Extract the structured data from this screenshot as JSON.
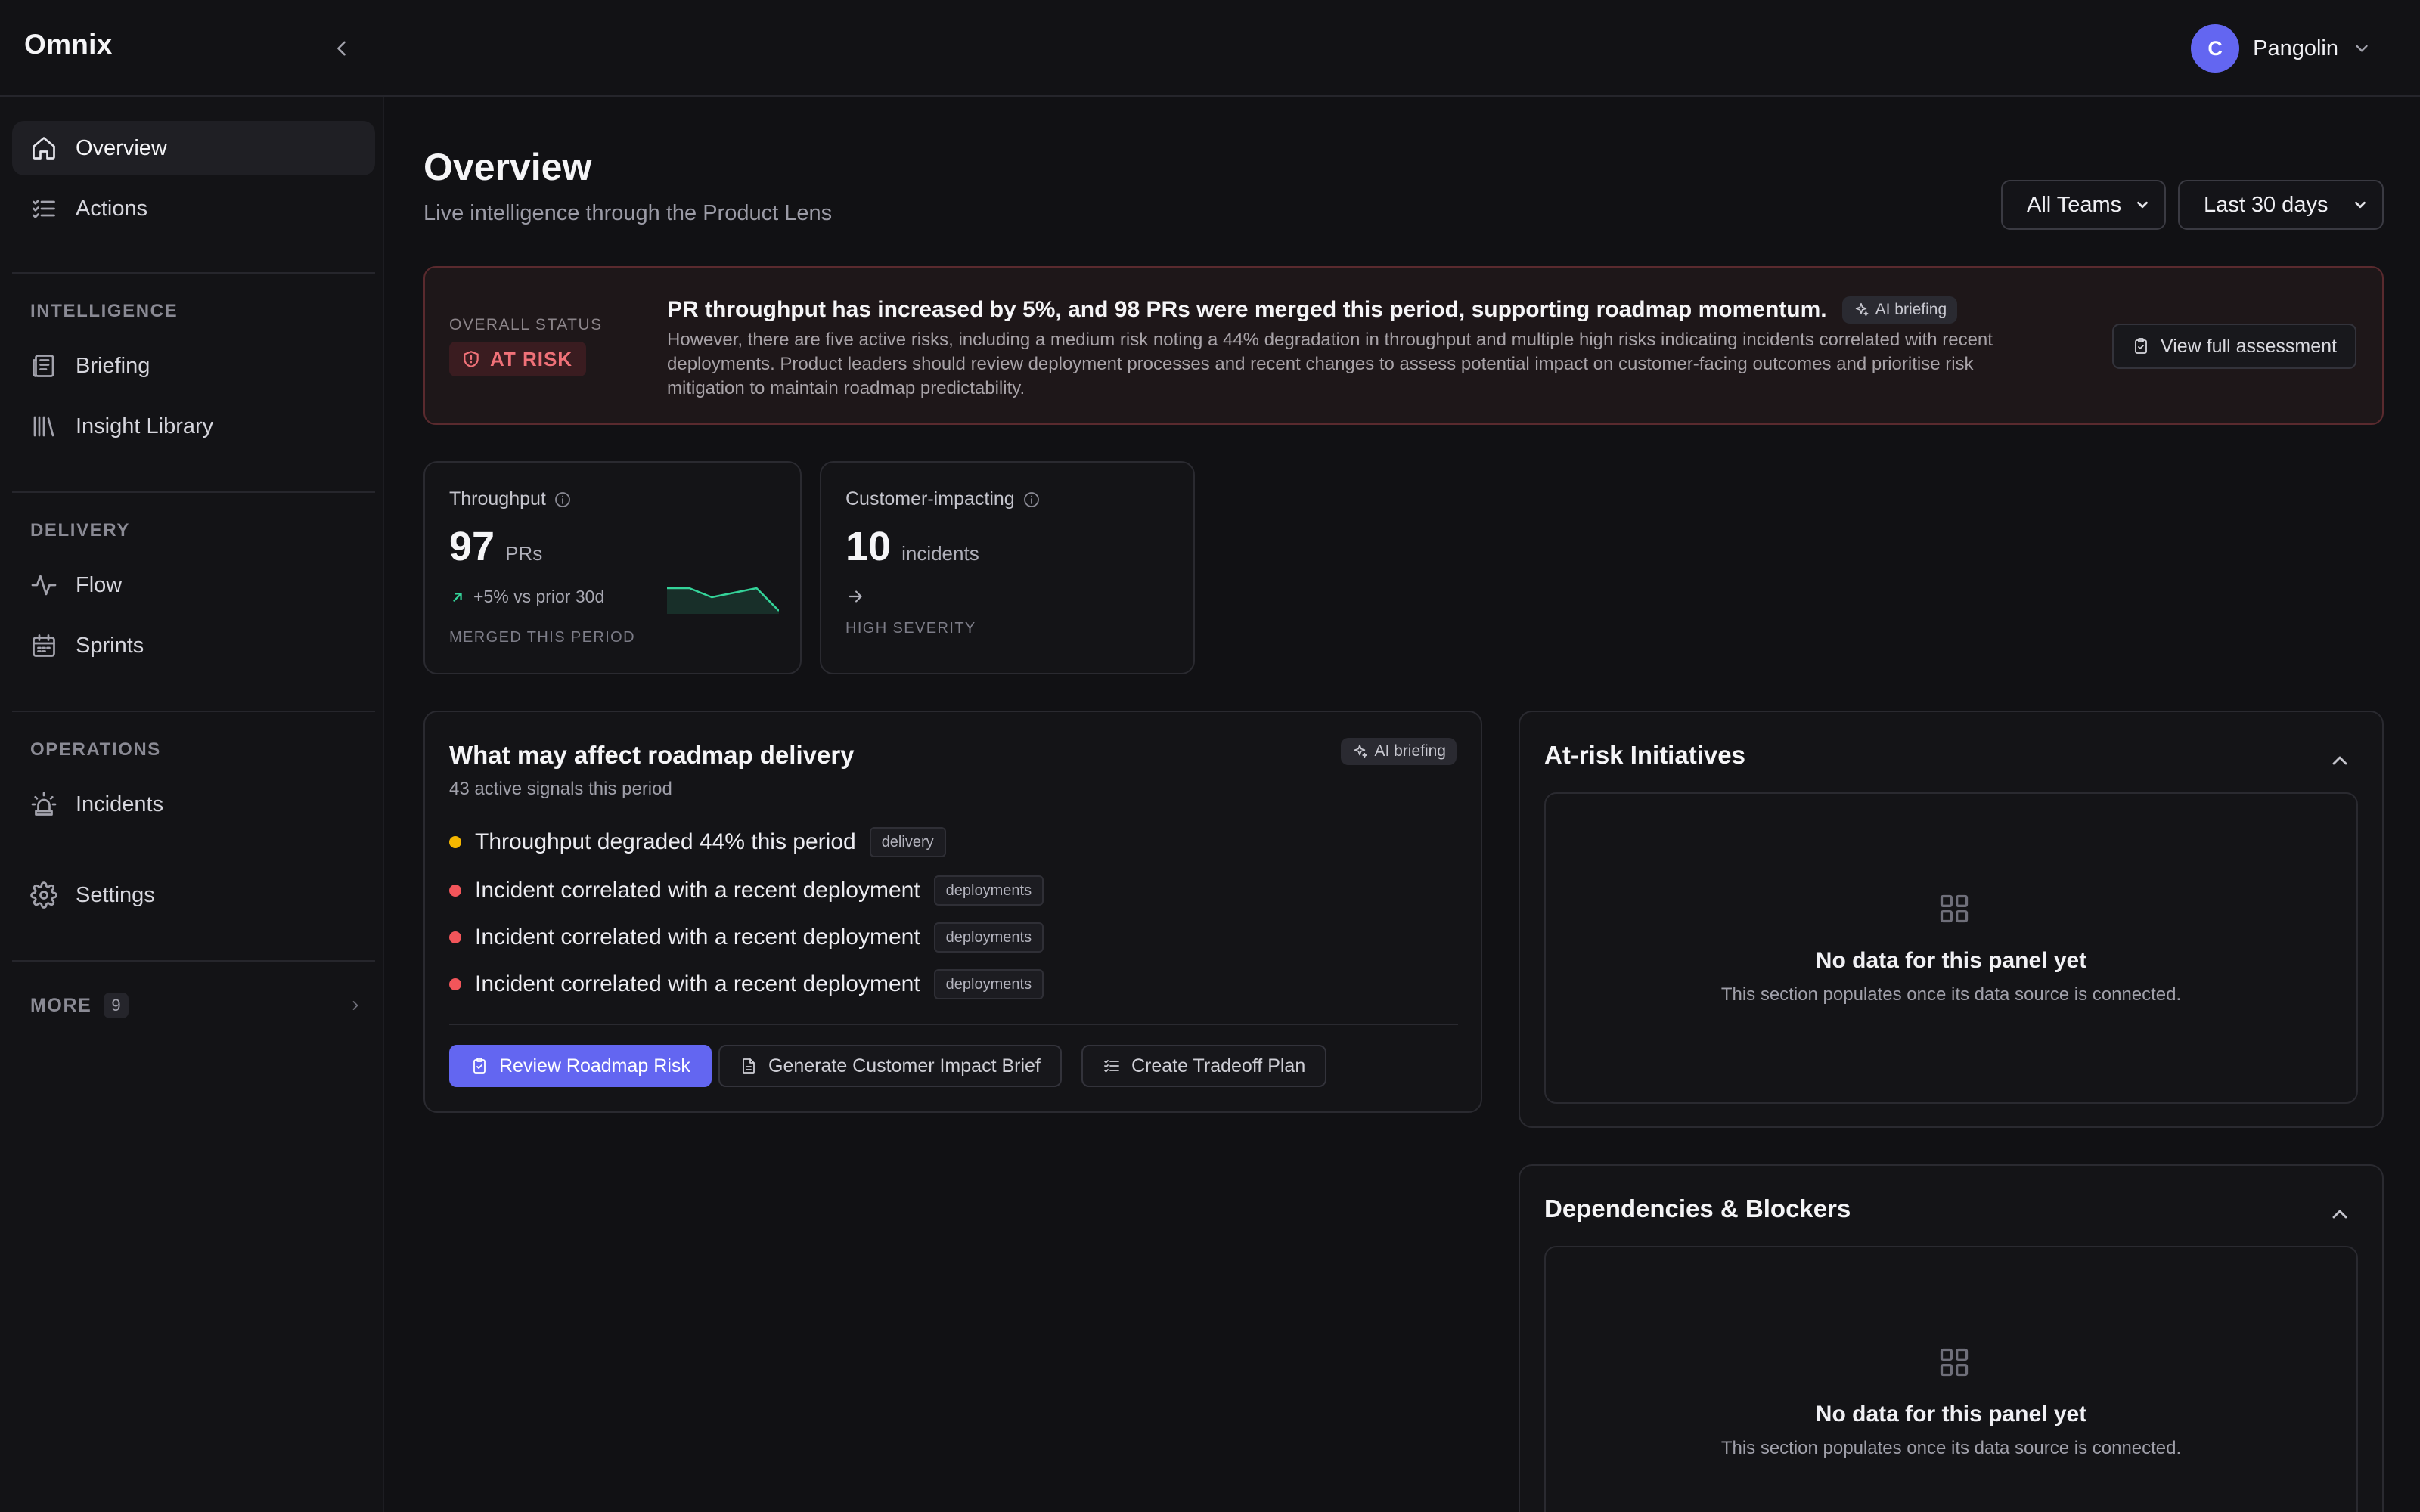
{
  "app": {
    "brand": "Omnix",
    "user": {
      "initial": "C",
      "name": "Pangolin"
    }
  },
  "sidebar": {
    "top_items": [
      {
        "label": "Overview",
        "icon": "home-icon",
        "active": true
      },
      {
        "label": "Actions",
        "icon": "checklist-icon",
        "active": false
      }
    ],
    "sections": [
      {
        "label": "INTELLIGENCE",
        "items": [
          {
            "label": "Briefing",
            "icon": "newspaper-icon"
          },
          {
            "label": "Insight Library",
            "icon": "library-icon"
          }
        ]
      },
      {
        "label": "DELIVERY",
        "items": [
          {
            "label": "Flow",
            "icon": "activity-icon"
          },
          {
            "label": "Sprints",
            "icon": "calendar-icon"
          }
        ]
      },
      {
        "label": "OPERATIONS",
        "items": [
          {
            "label": "Incidents",
            "icon": "siren-icon"
          }
        ]
      }
    ],
    "settings": {
      "label": "Settings",
      "icon": "gear-icon"
    },
    "more": {
      "label": "MORE",
      "count": "9"
    }
  },
  "header": {
    "title": "Overview",
    "subtitle": "Live intelligence through the Product Lens",
    "team_filter": "All Teams",
    "range_filter": "Last 30 days"
  },
  "status": {
    "label": "OVERALL STATUS",
    "badge": "AT RISK",
    "headline": "PR throughput has increased by 5%, and 98 PRs were merged this period, supporting roadmap momentum.",
    "ai_label": "AI briefing",
    "body": "However, there are five active risks, including a medium risk noting a 44% degradation in throughput and multiple high risks indicating incidents correlated with recent deployments. Product leaders should review deployment processes and recent changes to assess potential impact on customer-facing outcomes and prioritise risk mitigation to maintain roadmap predictability.",
    "button": "View full assessment"
  },
  "metrics": {
    "throughput": {
      "label": "Throughput",
      "value": "97",
      "unit": "PRs",
      "delta": "+5% vs prior 30d",
      "foot": "MERGED THIS PERIOD",
      "trend": [
        0.75,
        0.75,
        0.45,
        0.6,
        0.75,
        0.0
      ]
    },
    "incidents": {
      "label": "Customer-impacting",
      "value": "10",
      "unit": "incidents",
      "foot": "HIGH SEVERITY"
    }
  },
  "roadmap": {
    "title": "What may affect roadmap delivery",
    "subtitle": "43 active signals this period",
    "ai_label": "AI briefing",
    "signals": [
      {
        "text": "Throughput degraded 44% this period",
        "tag": "delivery",
        "color": "#f5b700"
      },
      {
        "text": "Incident correlated with a recent deployment",
        "tag": "deployments",
        "color": "#f2555a"
      },
      {
        "text": "Incident correlated with a recent deployment",
        "tag": "deployments",
        "color": "#f2555a"
      },
      {
        "text": "Incident correlated with a recent deployment",
        "tag": "deployments",
        "color": "#f2555a"
      }
    ],
    "actions": {
      "primary": "Review Roadmap Risk",
      "brief": "Generate Customer Impact Brief",
      "tradeoff": "Create Tradeoff Plan"
    }
  },
  "panels": {
    "at_risk": {
      "title": "At-risk Initiatives",
      "empty_title": "No data for this panel yet",
      "empty_text": "This section populates once its data source is connected."
    },
    "dependencies": {
      "title": "Dependencies & Blockers",
      "empty_title": "No data for this panel yet",
      "empty_text": "This section populates once its data source is connected."
    }
  },
  "colors": {
    "accent": "#6366f1",
    "risk": "#f07178",
    "positive": "#34d399",
    "warning": "#f5b700",
    "danger": "#f2555a"
  }
}
